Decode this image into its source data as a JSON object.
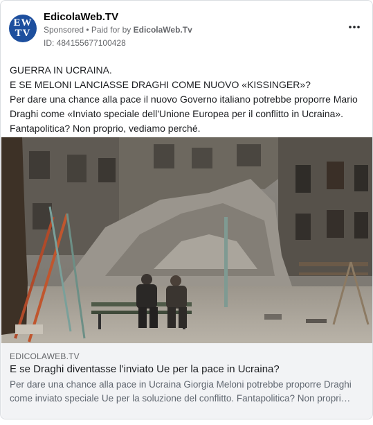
{
  "header": {
    "avatar_line1": "EW",
    "avatar_line2": "TV",
    "page_name": "EdicolaWeb.TV",
    "sponsored": "Sponsored",
    "separator": " • ",
    "paid_for_prefix": "Paid for by ",
    "paid_for_by": "EdicolaWeb.Tv",
    "ad_id": "ID: 484155677100428",
    "more_icon": "more-horizontal-icon"
  },
  "post": {
    "lines": [
      "GUERRA IN UCRAINA.",
      "E SE MELONI LANCIASSE DRAGHI COME NUOVO «KISSINGER»?",
      "Per dare una chance alla pace il nuovo Governo italiano potrebbe proporre Mario Draghi come «Inviato speciale dell'Unione Europea per il conflitto in Ucraina». Fantapolitica? Non proprio, vediamo perché."
    ]
  },
  "link": {
    "domain": "EDICOLAWEB.TV",
    "headline": "E se Draghi diventasse l'inviato Ue per la pace in Ucraina?",
    "description": "Per dare una chance alla pace in Ucraina Giorgia Meloni potrebbe proporre Draghi come inviato speciale Ue per la soluzione del conflitto. Fantapolitica? Non propri…"
  }
}
